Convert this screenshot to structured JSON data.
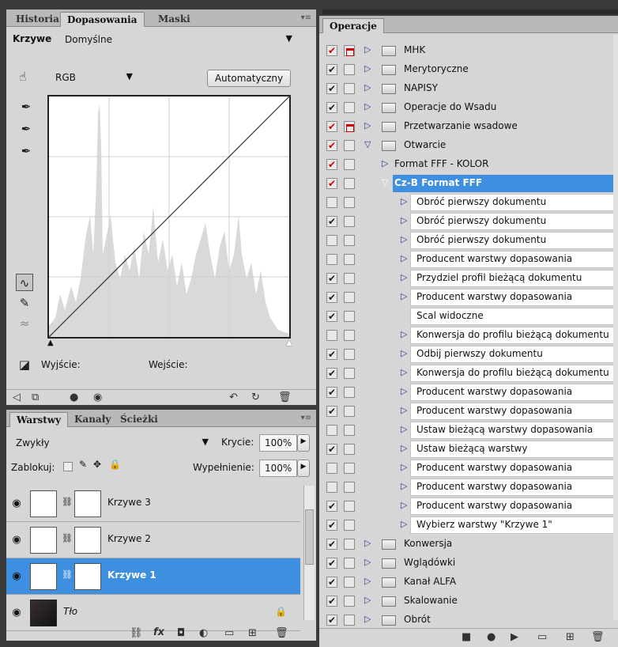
{
  "adjustments_panel": {
    "tabs": [
      "Historia",
      "Dopasowania",
      "Maski"
    ],
    "curves_label": "Krzywe",
    "preset_value": "Domyślne",
    "channel_value": "RGB",
    "auto_button": "Automatyczny",
    "output_label": "Wyjście:",
    "input_label": "Wejście:"
  },
  "layers_panel": {
    "tabs": [
      "Warstwy",
      "Kanały",
      "Ścieżki"
    ],
    "blend_mode": "Zwykły",
    "opacity_label": "Krycie:",
    "opacity_value": "100%",
    "lock_label": "Zablokuj:",
    "fill_label": "Wypełnienie:",
    "fill_value": "100%",
    "layers": [
      {
        "name": "Krzywe 3",
        "selected": false
      },
      {
        "name": "Krzywe 2",
        "selected": false
      },
      {
        "name": "Krzywe 1",
        "selected": true
      },
      {
        "name": "Tło",
        "selected": false
      }
    ]
  },
  "actions_panel": {
    "tab": "Operacje",
    "rows": [
      {
        "label": "MHK",
        "type": "set",
        "check": "red",
        "dialog": "red"
      },
      {
        "label": "Merytoryczne",
        "type": "set",
        "check": "black",
        "dialog": "none"
      },
      {
        "label": "NAPISY",
        "type": "set",
        "check": "black",
        "dialog": "none"
      },
      {
        "label": "Operacje do Wsadu",
        "type": "set",
        "check": "black",
        "dialog": "none"
      },
      {
        "label": "Przetwarzanie wsadowe",
        "type": "set",
        "check": "red",
        "dialog": "red"
      },
      {
        "label": "Otwarcie",
        "type": "set-open",
        "check": "red",
        "dialog": "none"
      },
      {
        "label": "Format FFF - KOLOR",
        "type": "action",
        "check": "red",
        "dialog": "none"
      },
      {
        "label": "Cz-B Format FFF",
        "type": "action-open-selected",
        "check": "red",
        "dialog": "none"
      },
      {
        "label": "Obróć pierwszy dokumentu",
        "type": "step",
        "check": "none",
        "dialog": "none"
      },
      {
        "label": "Obróć pierwszy dokumentu",
        "type": "step",
        "check": "black",
        "dialog": "none"
      },
      {
        "label": "Obróć pierwszy dokumentu",
        "type": "step",
        "check": "none",
        "dialog": "none"
      },
      {
        "label": "Producent warstwy dopasowania",
        "type": "step",
        "check": "none",
        "dialog": "none"
      },
      {
        "label": "Przydziel profil bieżącą dokumentu",
        "type": "step",
        "check": "black",
        "dialog": "none"
      },
      {
        "label": "Producent warstwy dopasowania",
        "type": "step",
        "check": "black",
        "dialog": "none"
      },
      {
        "label": "Scal widoczne",
        "type": "step-plain",
        "check": "black",
        "dialog": "none"
      },
      {
        "label": "Konwersja do profilu bieżącą dokumentu",
        "type": "step",
        "check": "none",
        "dialog": "none"
      },
      {
        "label": "Odbij pierwszy dokumentu",
        "type": "step",
        "check": "black",
        "dialog": "none"
      },
      {
        "label": "Konwersja do profilu bieżącą dokumentu",
        "type": "step",
        "check": "black",
        "dialog": "none"
      },
      {
        "label": "Producent warstwy dopasowania",
        "type": "step",
        "check": "black",
        "dialog": "none"
      },
      {
        "label": "Producent warstwy dopasowania",
        "type": "step",
        "check": "black",
        "dialog": "none"
      },
      {
        "label": "Ustaw bieżącą warstwy dopasowania",
        "type": "step",
        "check": "none",
        "dialog": "none"
      },
      {
        "label": "Ustaw bieżącą warstwy",
        "type": "step",
        "check": "black",
        "dialog": "none"
      },
      {
        "label": "Producent warstwy dopasowania",
        "type": "step",
        "check": "none",
        "dialog": "none"
      },
      {
        "label": "Producent warstwy dopasowania",
        "type": "step",
        "check": "none",
        "dialog": "none"
      },
      {
        "label": "Producent warstwy dopasowania",
        "type": "step",
        "check": "black",
        "dialog": "none"
      },
      {
        "label": "Wybierz warstwy \"Krzywe 1\"",
        "type": "step",
        "check": "black",
        "dialog": "none"
      },
      {
        "label": "Konwersja",
        "type": "set",
        "check": "black",
        "dialog": "none"
      },
      {
        "label": "Wglądówki",
        "type": "set",
        "check": "black",
        "dialog": "none"
      },
      {
        "label": "Kanał ALFA",
        "type": "set",
        "check": "black",
        "dialog": "none"
      },
      {
        "label": "Skalowanie",
        "type": "set",
        "check": "black",
        "dialog": "none"
      },
      {
        "label": "Obrót",
        "type": "set",
        "check": "black",
        "dialog": "none"
      }
    ]
  },
  "colors": {
    "selection_blue": "#3e8fe0",
    "check_red": "#cc0000",
    "panel_gray": "#d6d6d6"
  }
}
